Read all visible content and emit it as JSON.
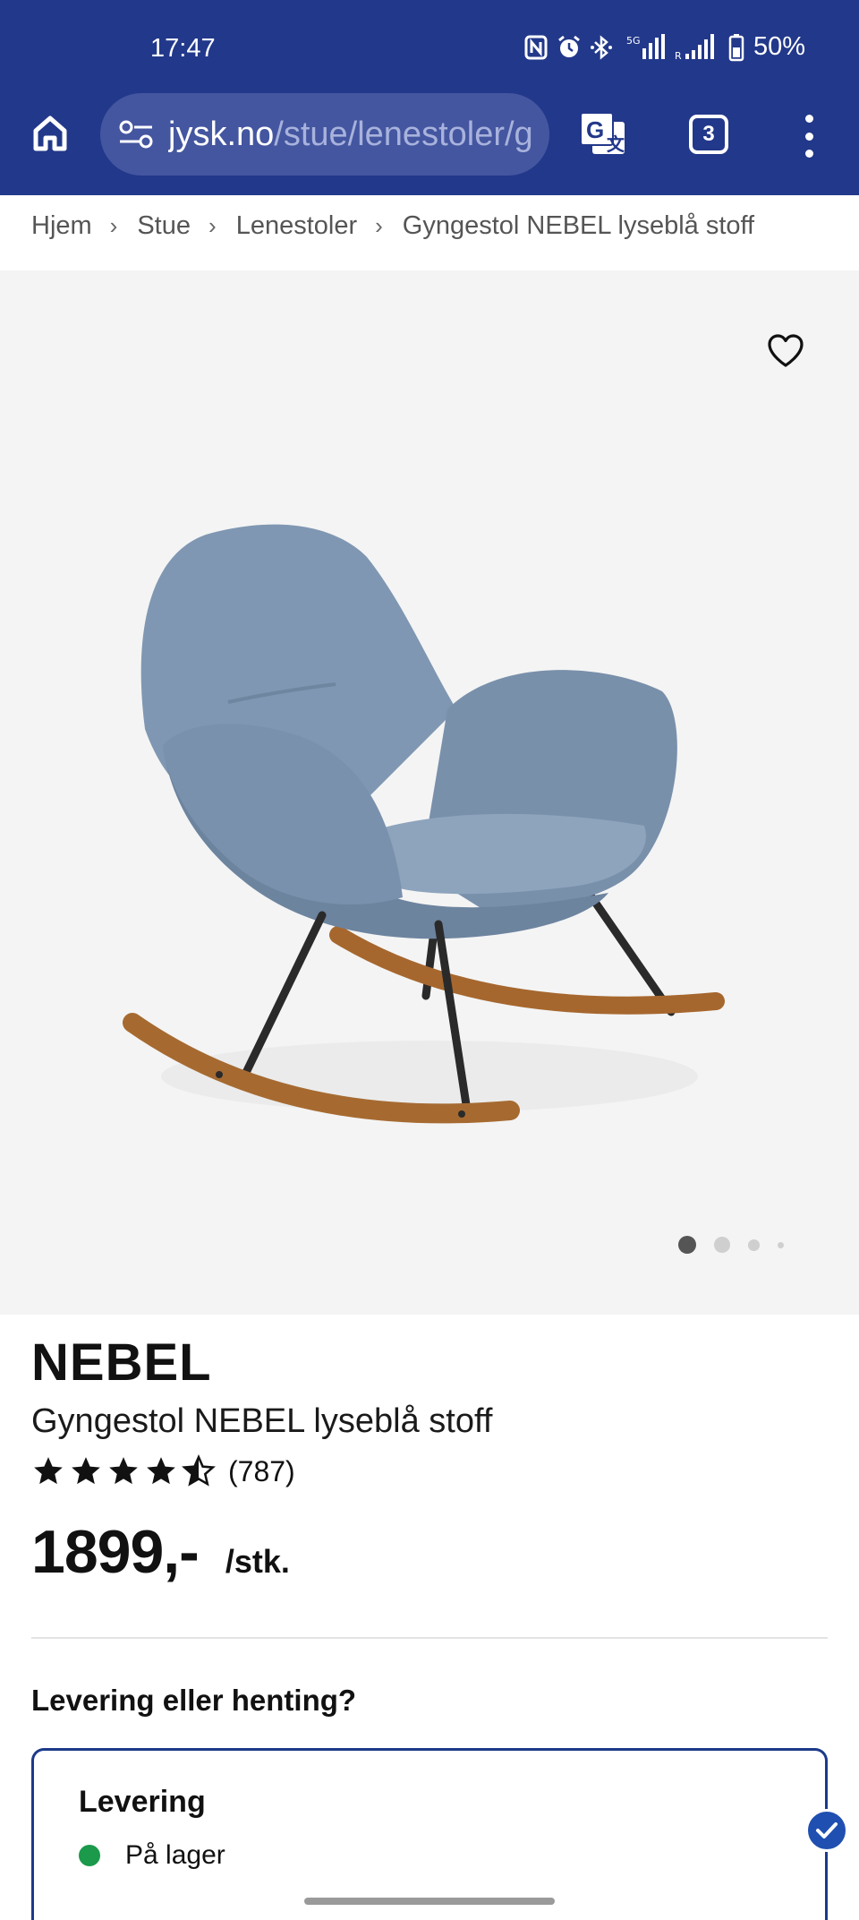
{
  "status_bar": {
    "time": "17:47",
    "battery": "50%"
  },
  "browser": {
    "url_host": "jysk.no",
    "url_path": "/stue/lenestoler/g",
    "tab_count": "3"
  },
  "breadcrumb": [
    "Hjem",
    "Stue",
    "Lenestoler",
    "Gyngestol NEBEL lyseblå stoff"
  ],
  "breadcrumb_separator": "›",
  "gallery": {
    "image_count": 4,
    "active_index": 0
  },
  "product": {
    "brand": "NEBEL",
    "name": "Gyngestol NEBEL lyseblå stoff",
    "rating": 4.5,
    "review_count": "(787)",
    "price": "1899,-",
    "unit": "/stk."
  },
  "delivery": {
    "question": "Levering eller henting?",
    "option_title": "Levering",
    "stock_status": "På lager",
    "stock_color": "#1a9a4a"
  },
  "colors": {
    "chrome": "#22388a",
    "accent": "#1c3a8a"
  },
  "icons": {
    "home": "home-icon",
    "site_settings": "tune-icon",
    "translate": "translate-icon",
    "menu": "more-vert-icon",
    "favorite": "heart-outline-icon",
    "selected": "check-icon"
  }
}
